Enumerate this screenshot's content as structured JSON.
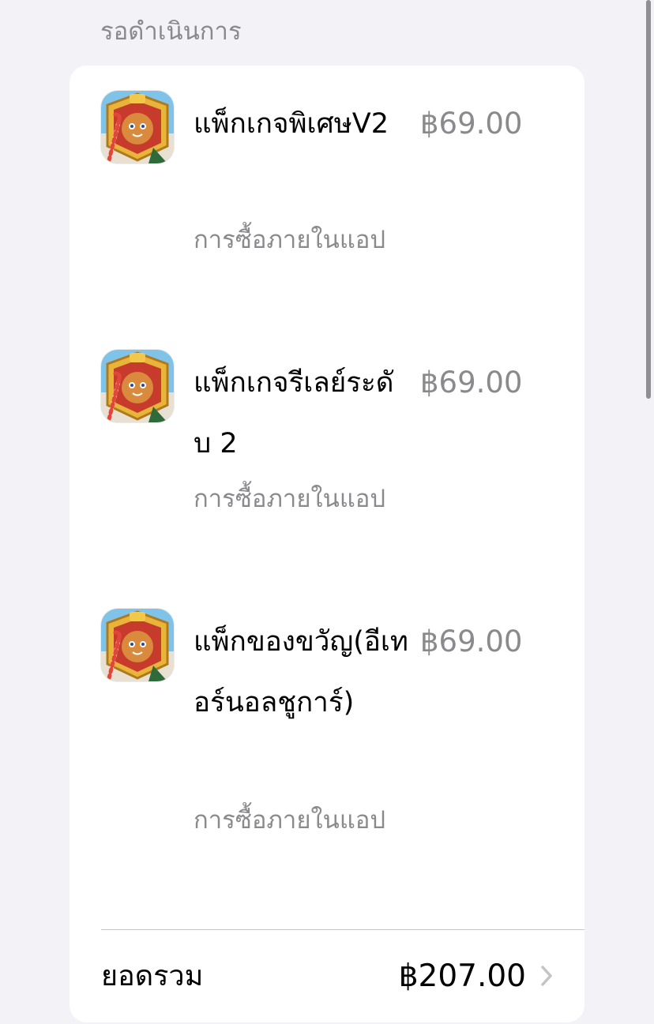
{
  "section": {
    "title": "รอดำเนินการ"
  },
  "items": [
    {
      "title": "แพ็กเกจพิเศษV2",
      "subtitle": "การซื้อภายในแอป",
      "price": "฿69.00",
      "icon": "cookie-run-app-icon"
    },
    {
      "title": "แพ็กเกจรีเลย์ระดับ 2",
      "subtitle": "การซื้อภายในแอป",
      "price": "฿69.00",
      "icon": "cookie-run-app-icon"
    },
    {
      "title": "แพ็กของขวัญ(อีเทอร์นอลชูการ์)",
      "subtitle": "การซื้อภายในแอป",
      "price": "฿69.00",
      "icon": "cookie-run-app-icon"
    }
  ],
  "total": {
    "label": "ยอดรวม",
    "value": "฿207.00"
  },
  "colors": {
    "background": "#f2f2f7",
    "card": "#ffffff",
    "secondary_text": "#8a8a8e",
    "primary_text": "#000000",
    "chevron": "#c4c4c7"
  }
}
